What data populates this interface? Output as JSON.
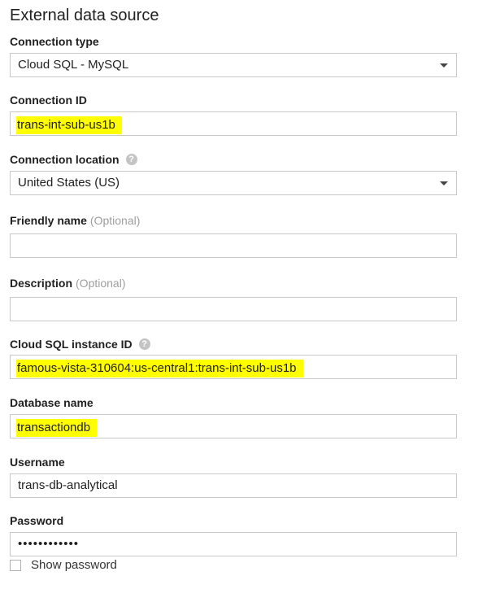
{
  "title": "External data source",
  "fields": {
    "connection_type": {
      "label": "Connection type",
      "value": "Cloud SQL - MySQL"
    },
    "connection_id": {
      "label": "Connection ID",
      "value": "trans-int-sub-us1b"
    },
    "connection_location": {
      "label": "Connection location",
      "value": "United States (US)",
      "help": "?"
    },
    "friendly_name": {
      "label": "Friendly name",
      "optional": "(Optional)",
      "value": ""
    },
    "description": {
      "label": "Description",
      "optional": "(Optional)",
      "value": ""
    },
    "instance_id": {
      "label": "Cloud SQL instance ID",
      "value": "famous-vista-310604:us-central1:trans-int-sub-us1b",
      "help": "?"
    },
    "database_name": {
      "label": "Database name",
      "value": "transactiondb"
    },
    "username": {
      "label": "Username",
      "value": "trans-db-analytical"
    },
    "password": {
      "label": "Password",
      "value": "••••••••••••"
    }
  },
  "show_password": {
    "label": "Show password",
    "checked": false
  },
  "colors": {
    "highlight": "#ffff00",
    "border": "#c8c8c8",
    "muted": "#9e9e9e"
  }
}
